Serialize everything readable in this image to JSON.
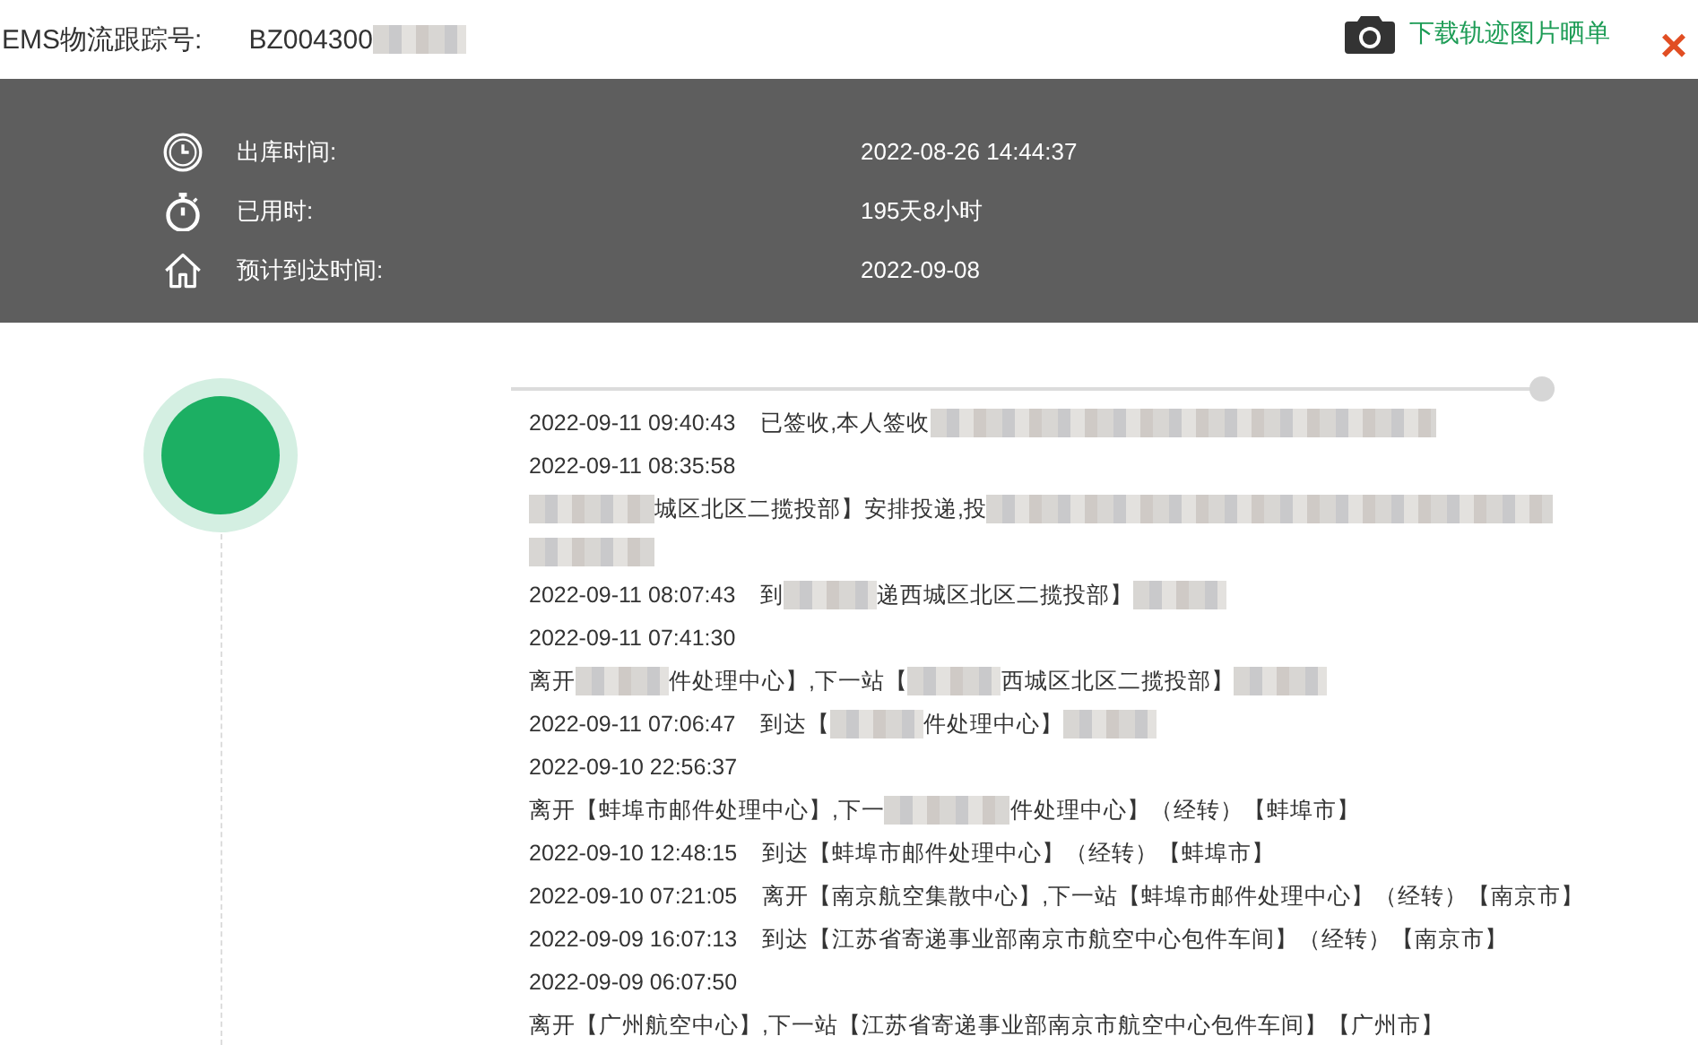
{
  "header": {
    "label": "EMS物流跟踪号:",
    "number": "BZ004300",
    "number_blurred": true,
    "download_link": "下载轨迹图片晒单",
    "close": "×"
  },
  "summary": [
    {
      "kind": "clock",
      "label": "出库时间:",
      "value": "2022-08-26 14:44:37"
    },
    {
      "kind": "stopwatch",
      "label": "已用时:",
      "value": "195天8小时"
    },
    {
      "kind": "home",
      "label": "预计到达时间:",
      "value": "2022-09-08"
    }
  ],
  "events": [
    {
      "time": "2022-09-11 09:40:43",
      "kind": "inline",
      "parts": [
        {
          "kind": "text",
          "text": "已签收,本人签收"
        },
        {
          "kind": "blur_long"
        }
      ]
    },
    {
      "time": "2022-09-11 08:35:58",
      "kind": "stacked",
      "parts": [
        {
          "kind": "blur_medium"
        },
        {
          "kind": "text",
          "text": "城区北区二揽投部】安排投递,投"
        },
        {
          "kind": "blur_longer"
        },
        {
          "kind": "break"
        },
        {
          "kind": "blur_medium"
        }
      ]
    },
    {
      "time": "2022-09-11 08:07:43",
      "kind": "inline",
      "parts": [
        {
          "kind": "text",
          "text": "到"
        },
        {
          "kind": "blur_short"
        },
        {
          "kind": "text",
          "text": "递西城区北区二揽投部】"
        },
        {
          "kind": "blur_short"
        }
      ]
    },
    {
      "time": "2022-09-11 07:41:30",
      "kind": "stacked",
      "parts": [
        {
          "kind": "text",
          "text": "离开"
        },
        {
          "kind": "blur_short"
        },
        {
          "kind": "text",
          "text": "件处理中心】,下一站【"
        },
        {
          "kind": "blur_short"
        },
        {
          "kind": "text",
          "text": "西城区北区二揽投部】"
        },
        {
          "kind": "blur_short"
        }
      ]
    },
    {
      "time": "2022-09-11 07:06:47",
      "kind": "inline",
      "parts": [
        {
          "kind": "text",
          "text": "到达【"
        },
        {
          "kind": "blur_short"
        },
        {
          "kind": "text",
          "text": "件处理中心】"
        },
        {
          "kind": "blur_short"
        }
      ]
    },
    {
      "time": "2022-09-10 22:56:37",
      "kind": "stacked",
      "parts": [
        {
          "kind": "text",
          "text": "离开【蚌埠市邮件处理中心】,下一"
        },
        {
          "kind": "blur_medium"
        },
        {
          "kind": "text",
          "text": "件处理中心】（经转）【蚌埠市】"
        }
      ]
    },
    {
      "time": "2022-09-10 12:48:15",
      "kind": "inline",
      "parts": [
        {
          "kind": "text",
          "text": "到达【蚌埠市邮件处理中心】（经转）【蚌埠市】"
        }
      ]
    },
    {
      "time": "2022-09-10 07:21:05",
      "kind": "inline",
      "parts": [
        {
          "kind": "text",
          "text": "离开【南京航空集散中心】,下一站【蚌埠市邮件处理中心】（经转）【南京市】"
        }
      ]
    },
    {
      "time": "2022-09-09 16:07:13",
      "kind": "inline",
      "parts": [
        {
          "kind": "text",
          "text": "到达【江苏省寄递事业部南京市航空中心包件车间】（经转）【南京市】"
        }
      ]
    },
    {
      "time": "2022-09-09 06:07:50",
      "kind": "stacked",
      "parts": [
        {
          "kind": "text",
          "text": "离开【广州航空中心】,下一站【江苏省寄递事业部南京市航空中心包件车间】【广州市】"
        }
      ]
    }
  ]
}
